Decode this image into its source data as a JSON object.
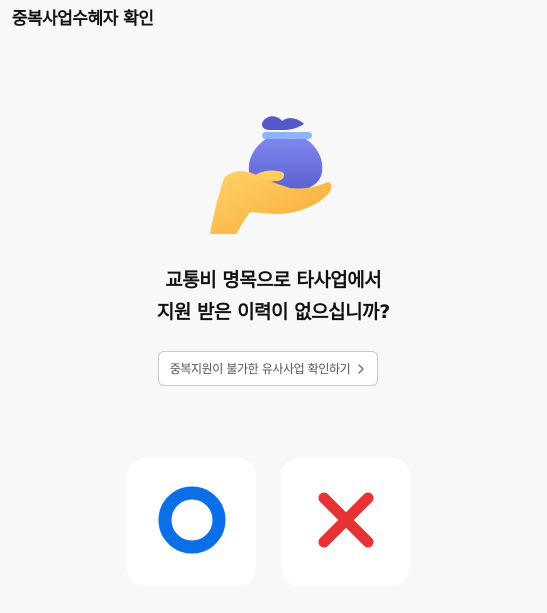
{
  "header": {
    "title": "중복사업수혜자 확인"
  },
  "question": {
    "line1": "교통비 명목으로 타사업에서",
    "line2": "지원 받은 이력이 없으십니까?"
  },
  "check_link": {
    "label": "중복지원이 불가한 유사사업 확인하기",
    "icon": "chevron-right-icon"
  },
  "answers": {
    "yes_icon": "circle-o-icon",
    "no_icon": "x-mark-icon"
  },
  "colors": {
    "yes": "#0b6fe8",
    "no": "#e63232",
    "hand": "#fbbf4a",
    "bag": "#6a6fd8"
  }
}
